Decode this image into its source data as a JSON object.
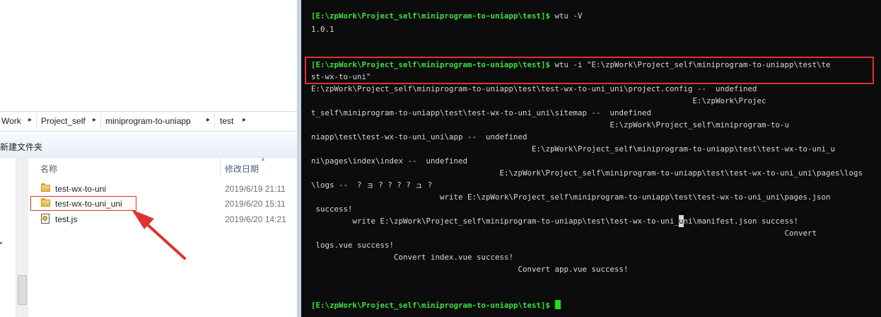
{
  "explorer": {
    "breadcrumb": [
      "Work",
      "Project_self",
      "miniprogram-to-uniapp",
      "test"
    ],
    "toolbar": {
      "new_folder": "新建文件夹"
    },
    "columns": {
      "name": "名称",
      "modified": "修改日期"
    },
    "files": [
      {
        "name": "test-wx-to-uni",
        "type": "folder",
        "modified": "2019/6/19 21:11"
      },
      {
        "name": "test-wx-to-uni_uni",
        "type": "folder",
        "modified": "2019/6/20 15:11",
        "highlighted": true
      },
      {
        "name": "test.js",
        "type": "js-file",
        "modified": "2019/6/20 14:21"
      }
    ],
    "accent_color": "#e0312e"
  },
  "terminal": {
    "prompt": "[E:\\zpWork\\Project_self\\miniprogram-to-uniapp\\test]$",
    "cmd1": " wtu -V",
    "out1": "1.0.1",
    "cmd2_line1": " wtu -i \"E:\\zpWork\\Project_self\\miniprogram-to-uniapp\\test\\te",
    "cmd2_line2": "st-wx-to-uni\"",
    "output": [
      "E:\\zpWork\\Project_self\\miniprogram-to-uniapp\\test\\test-wx-to-uni_uni\\project.config --  undefined",
      "                                                                                   E:\\zpWork\\Projec",
      "t_self\\miniprogram-to-uniapp\\test\\test-wx-to-uni_uni\\sitemap --  undefined",
      "                                                                 E:\\zpWork\\Project_self\\miniprogram-to-u",
      "niapp\\test\\test-wx-to-uni_uni\\app --  undefined",
      "                                                E:\\zpWork\\Project_self\\miniprogram-to-uniapp\\test\\test-wx-to-uni_u",
      "ni\\pages\\index\\index --  undefined",
      "                                         E:\\zpWork\\Project_self\\miniprogram-to-uniapp\\test\\test-wx-to-uni_uni\\pages\\logs",
      "\\logs --  ? ョ ? ? ? ? ュ ?",
      "                            write E:\\zpWork\\Project_self\\miniprogram-to-uniapp\\test\\test-wx-to-uni_uni\\pages.json",
      " success!",
      "         write E:\\zpWork\\Project_self\\miniprogram-to-uniapp\\test\\test-wx-to-uni_",
      "                                                                                                       Convert",
      " logs.vue success!",
      "                  Convert index.vue success!",
      "                                             Convert app.vue success!"
    ],
    "line12_cursor_char": "u",
    "line12_rest": "ni\\manifest.json success!",
    "colors": {
      "background": "#0c0c0c",
      "prompt": "#3be03b",
      "text": "#d8d8d8",
      "cursor": "#18e318"
    }
  }
}
